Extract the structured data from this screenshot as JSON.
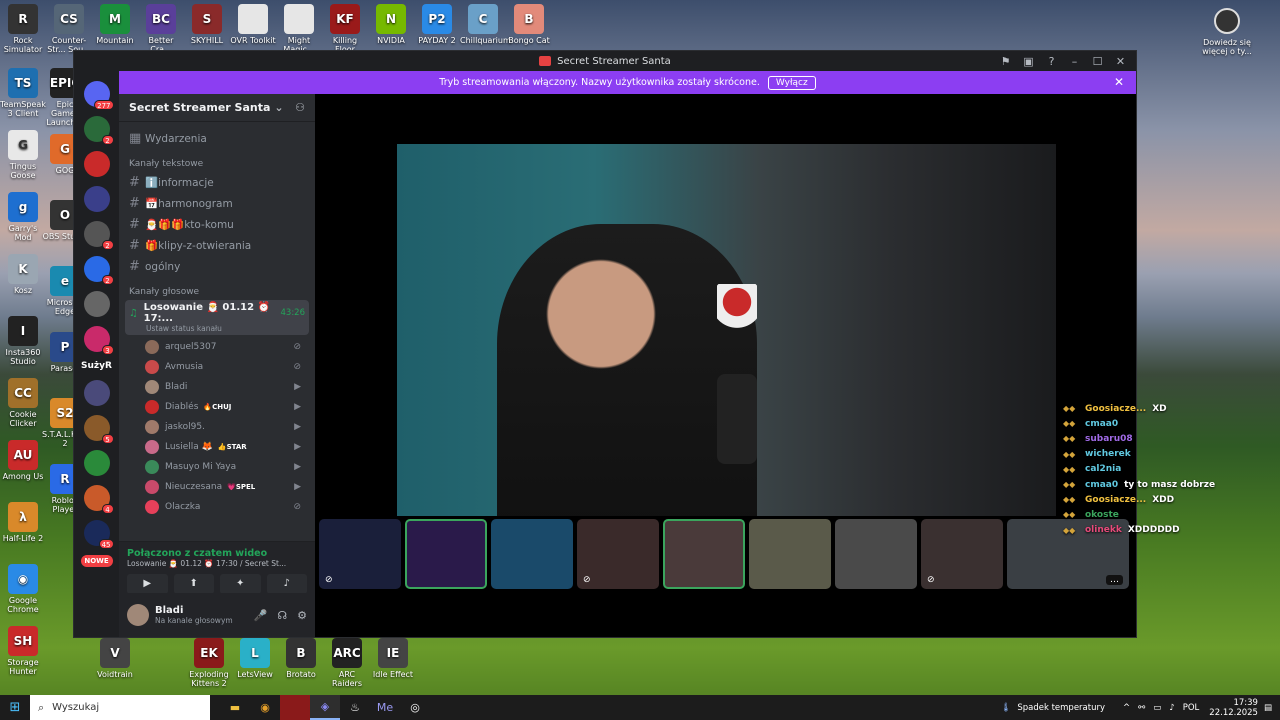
{
  "desktop": {
    "top_icons": [
      {
        "label": "Rock Simulator",
        "color": "#333333",
        "glyph": "R"
      },
      {
        "label": "Counter-Str... Sou...",
        "color": "#556677",
        "glyph": "CS"
      },
      {
        "label": "Mountain",
        "color": "#1a8f3c",
        "glyph": "M"
      },
      {
        "label": "Better Cra...",
        "color": "#5a3f9a",
        "glyph": "BC"
      },
      {
        "label": "SKYHILL",
        "color": "#8a2a2a",
        "glyph": "S"
      },
      {
        "label": "OVR Toolkit",
        "color": "#e6e6e6",
        "glyph": ""
      },
      {
        "label": "Might Magic...",
        "color": "#e6e6e6",
        "glyph": ""
      },
      {
        "label": "Killing Floor",
        "color": "#9a1a1a",
        "glyph": "KF"
      },
      {
        "label": "NVIDIA",
        "color": "#76b900",
        "glyph": "N"
      },
      {
        "label": "PAYDAY 2",
        "color": "#2a8ae6",
        "glyph": "P2"
      },
      {
        "label": "Chillquarium",
        "color": "#6aa0c8",
        "glyph": "C"
      },
      {
        "label": "Bongo Cat",
        "color": "#e28a7a",
        "glyph": "B"
      }
    ],
    "left_icons": [
      {
        "label": "TeamSpeak 3 Client",
        "color": "#1e6fb0",
        "glyph": "TS"
      },
      {
        "label": "Tingus Goose",
        "color": "#e8e8e8",
        "glyph": "G"
      },
      {
        "label": "Garry's Mod",
        "color": "#1e6fd0",
        "glyph": "g"
      },
      {
        "label": "Kosz",
        "color": "#9aa6b2",
        "glyph": "K"
      },
      {
        "label": "Insta360 Studio",
        "color": "#222222",
        "glyph": "I"
      },
      {
        "label": "Cookie Clicker",
        "color": "#a0702a",
        "glyph": "CC"
      },
      {
        "label": "Among Us",
        "color": "#c92a2a",
        "glyph": "AU"
      },
      {
        "label": "Half-Life 2",
        "color": "#d9892a",
        "glyph": "λ"
      },
      {
        "label": "Google Chrome",
        "color": "#2a8ae6",
        "glyph": "◉"
      },
      {
        "label": "Storage Hunter",
        "color": "#c92a2a",
        "glyph": "SH"
      }
    ],
    "second_col_icons": [
      {
        "label": "Epic Games Launcher",
        "color": "#222222",
        "glyph": "EPIC"
      },
      {
        "label": "GOG",
        "color": "#e06a2a",
        "glyph": "G"
      },
      {
        "label": "OBS Studio",
        "color": "#333333",
        "glyph": "O"
      },
      {
        "label": "Microsoft Edge",
        "color": "#1a8ab0",
        "glyph": "e"
      },
      {
        "label": "Parasol",
        "color": "#2a4a8a",
        "glyph": "P"
      },
      {
        "label": "S.T.A.L.K.E.R. 2",
        "color": "#d9892a",
        "glyph": "S2"
      },
      {
        "label": "Roblox Player",
        "color": "#2a6ae6",
        "glyph": "R"
      }
    ],
    "bottom_icons": [
      {
        "label": "Voidtrain",
        "color": "#444444",
        "glyph": "V"
      },
      {
        "label": "Exploding Kittens 2",
        "color": "#8a1a1a",
        "glyph": "EK"
      },
      {
        "label": "LetsView",
        "color": "#2ab0c8",
        "glyph": "L"
      },
      {
        "label": "Brotato",
        "color": "#333333",
        "glyph": "B"
      },
      {
        "label": "ARC Raiders",
        "color": "#222222",
        "glyph": "ARC"
      },
      {
        "label": "Idle Effect",
        "color": "#444444",
        "glyph": "IE"
      }
    ],
    "widget_label": "Dowiedz się więcej o ty..."
  },
  "window": {
    "title": "Secret Streamer Santa",
    "title_actions": [
      "⚑",
      "▣",
      "?",
      "–",
      "☐",
      "✕"
    ]
  },
  "banner": {
    "text": "Tryb streamowania włączony. Nazwy użytkownika zostały skrócone.",
    "button": "Wyłącz",
    "close": "✕"
  },
  "rail": {
    "dm_badge": "277",
    "servers": [
      {
        "color": "#2a6a3a",
        "badge": "2"
      },
      {
        "color": "#c92a2a",
        "badge": ""
      },
      {
        "color": "#3a3f8a",
        "badge": ""
      },
      {
        "color": "#555555",
        "badge": "2"
      },
      {
        "color": "#2a6ae6",
        "badge": "2"
      },
      {
        "color": "#666666",
        "badge": ""
      },
      {
        "color": "#c92a6a",
        "badge": "3"
      }
    ],
    "text_server": "SużyR",
    "servers2": [
      {
        "color": "#4a4a7a",
        "badge": ""
      },
      {
        "color": "#8a5a2a",
        "badge": "5"
      },
      {
        "color": "#2a8a3a",
        "badge": ""
      },
      {
        "color": "#c95a2a",
        "badge": "4"
      },
      {
        "color": "#1a2a5a",
        "badge": "45"
      }
    ],
    "nowe_label": "NOWE"
  },
  "sidebar": {
    "guild_name": "Secret Streamer Santa",
    "events_label": "Wydarzenia",
    "text_category": "Kanały tekstowe",
    "text_channels": [
      {
        "name": "ℹ️informacje"
      },
      {
        "name": "📅harmonogram"
      },
      {
        "name": "🎅🎁🎁kto-komu"
      },
      {
        "name": "🎁klipy-z-otwierania"
      },
      {
        "name": "ogólny"
      }
    ],
    "voice_category": "Kanały głosowe",
    "voice_channel": {
      "name": "Losowanie 🎅 01.12 ⏰ 17:...",
      "timer": "43:26",
      "status": "Ustaw status kanału"
    },
    "voice_users": [
      {
        "name": "arquel5307",
        "color": "#8a6a5a",
        "tag": "",
        "icon": "⊘"
      },
      {
        "name": "Avmusia",
        "color": "#c94a4a",
        "tag": "",
        "icon": "⊘"
      },
      {
        "name": "Bladi",
        "color": "#a08878",
        "tag": "",
        "icon": "▶"
      },
      {
        "name": "Diablés",
        "color": "#c92a2a",
        "tag": "🔥CHUJ",
        "icon": "▶"
      },
      {
        "name": "jaskol95.",
        "color": "#a07a6a",
        "tag": "",
        "icon": "▶"
      },
      {
        "name": "Lusiella 🦊",
        "color": "#c96a8a",
        "tag": "👍STAR",
        "icon": "▶"
      },
      {
        "name": "Masuyo Mi Yaya",
        "color": "#3a8a5a",
        "tag": "",
        "icon": "▶"
      },
      {
        "name": "Nieuczesana",
        "color": "#c94a6a",
        "tag": "💗SPEL",
        "icon": "▶"
      },
      {
        "name": "Olaczka",
        "color": "#e6405a",
        "tag": "",
        "icon": "⊘"
      }
    ],
    "voice_panel": {
      "connected": "Połączono z czatem wideo",
      "channel": "Losowanie 🎅 01.12 ⏰ 17:30 / Secret St..."
    },
    "user": {
      "name": "Bladi",
      "status": "Na kanale głosowym"
    }
  },
  "tiles": [
    {
      "color": "#1a1f3a",
      "selected": false
    },
    {
      "color": "#2a1a4a",
      "selected": true
    },
    {
      "color": "#1a4a6a",
      "selected": false
    },
    {
      "color": "#3a2a2a",
      "selected": false
    },
    {
      "color": "#4a3a3a",
      "selected": true
    },
    {
      "color": "#5a5a4a",
      "selected": false
    },
    {
      "color": "#4a4a4a",
      "selected": false
    },
    {
      "color": "#3a3030",
      "selected": false
    }
  ],
  "chat": [
    {
      "name": "Goosiacze...",
      "color": "#f0c040",
      "text": "XD"
    },
    {
      "name": "cmaa0",
      "color": "#60c8e0",
      "text": ""
    },
    {
      "name": "subaru08",
      "color": "#a06ae6",
      "text": ""
    },
    {
      "name": "wicherek",
      "color": "#60c8e0",
      "text": ""
    },
    {
      "name": "cal2nia",
      "color": "#60c8e0",
      "text": ""
    },
    {
      "name": "cmaa0",
      "color": "#60c8e0",
      "text": "ty to masz dobrze"
    },
    {
      "name": "Goosiacze...",
      "color": "#f0c040",
      "text": "XDD"
    },
    {
      "name": "okoste",
      "color": "#3ba55d",
      "text": ""
    },
    {
      "name": "olinekk",
      "color": "#e64a7a",
      "text": "XDDDDDD"
    }
  ],
  "taskbar": {
    "search_placeholder": "Wyszukaj",
    "weather": "Spadek temperatury",
    "lang": "POL",
    "time": "17:39",
    "date": "22.12.2025"
  }
}
